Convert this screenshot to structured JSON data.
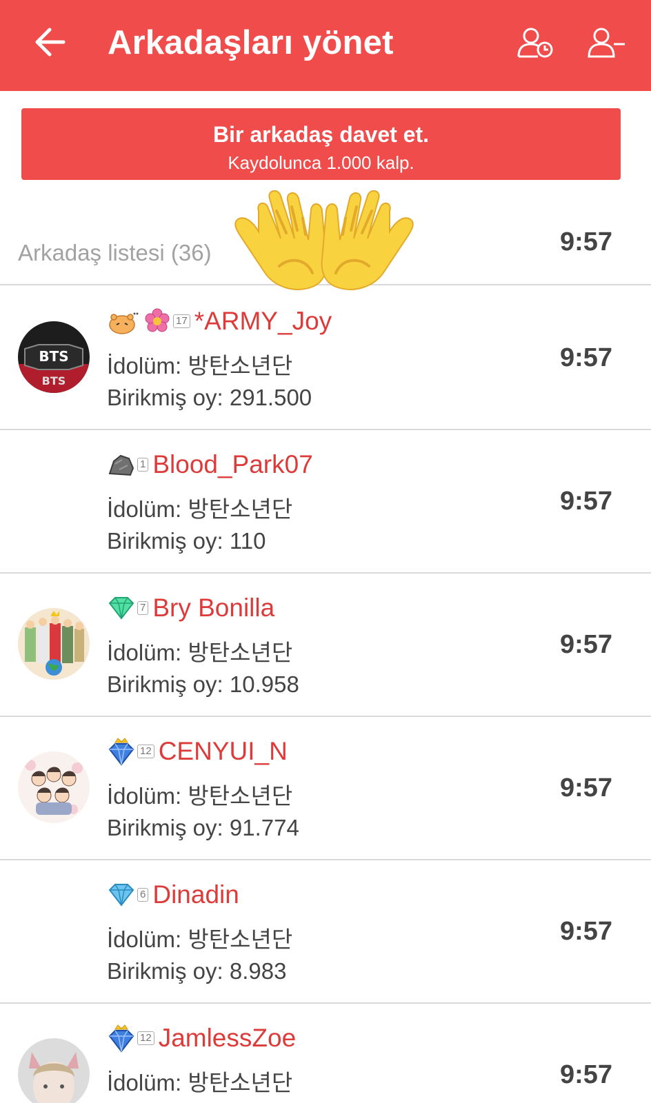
{
  "header": {
    "title": "Arkadaşları yönet",
    "back_icon": "arrow-left-icon",
    "icons": [
      "user-clock-icon",
      "user-minus-icon"
    ],
    "background": "#ef4c4b"
  },
  "invite": {
    "title": "Bir arkadaş davet et.",
    "subtitle": "Kaydolunca 1.000 kalp."
  },
  "list": {
    "count_label": "Arkadaş listesi (36)",
    "header_time": "9:57",
    "sticker": "raising-hands-emoji",
    "idol_prefix": "İdolüm:",
    "votes_prefix": "Birikmiş oy:"
  },
  "friends": [
    {
      "name": "*ARMY_Joy",
      "badge": "pink-flower-badge",
      "extra": "hamster-icon",
      "level": "17",
      "idol": "방탄소년단",
      "votes": "291.500",
      "time": "9:57",
      "avatar": "bts-logo"
    },
    {
      "name": "Blood_Park07",
      "badge": "stone-badge",
      "level": "1",
      "idol": "방탄소년단",
      "votes": "110",
      "time": "9:57",
      "avatar": "none"
    },
    {
      "name": "Bry Bonilla",
      "badge": "green-diamond-badge",
      "level": "7",
      "idol": "방탄소년단",
      "votes": "10.958",
      "time": "9:57",
      "avatar": "group-photo"
    },
    {
      "name": "CENYUI_N",
      "badge": "blue-crown-diamond-badge",
      "level": "12",
      "idol": "방탄소년단",
      "votes": "91.774",
      "time": "9:57",
      "avatar": "cartoon-group"
    },
    {
      "name": "Dinadin",
      "badge": "blue-diamond-badge",
      "level": "6",
      "idol": "방탄소년단",
      "votes": "8.983",
      "time": "9:57",
      "avatar": "none"
    },
    {
      "name": "JamlessZoe",
      "badge": "blue-crown-diamond-badge",
      "level": "12",
      "idol": "방탄소년단",
      "votes": "",
      "time": "9:57",
      "avatar": "person-photo"
    }
  ]
}
